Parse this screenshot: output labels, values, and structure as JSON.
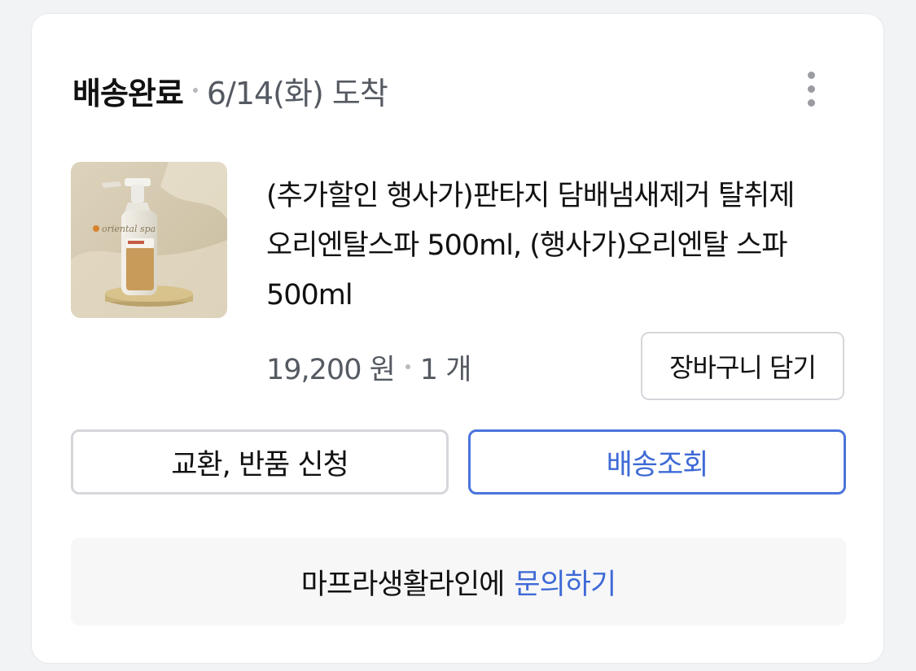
{
  "order": {
    "status": "배송완료",
    "arrival": "6/14(화) 도착",
    "more_icon": "more-vertical-icon"
  },
  "product": {
    "title": "(추가할인 행사가)판타지 담배냄새제거 탈취제 오리엔탈스파 500ml, (행사가)오리엔탈 스파 500ml",
    "price": "19,200 원",
    "quantity": "1 개",
    "image_text": "oriental spa"
  },
  "actions": {
    "add_to_cart": "장바구니 담기",
    "return_exchange": "교환, 반품 신청",
    "track_delivery": "배송조회"
  },
  "inquiry": {
    "seller_text": "마프라생활라인에",
    "link_text": "문의하기"
  },
  "colors": {
    "accent": "#3e6ad6",
    "text_primary": "#111111",
    "text_secondary": "#555a62"
  }
}
